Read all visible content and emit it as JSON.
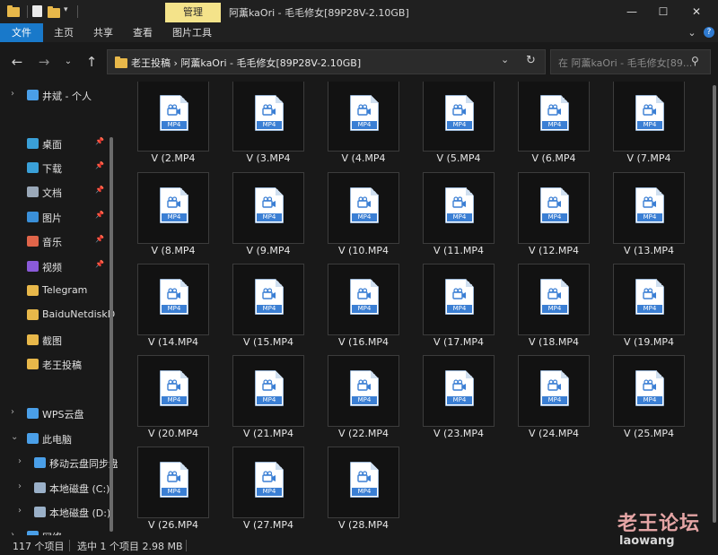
{
  "titlebar": {
    "manage_tab": "管理",
    "window_title": "阿薰kaOri - 毛毛修女[89P28V-2.10GB]",
    "minimize": "—",
    "maximize": "☐",
    "close": "✕"
  },
  "ribbon": {
    "tabs": [
      "文件",
      "主页",
      "共享",
      "查看",
      "图片工具"
    ]
  },
  "address": {
    "crumbs": "老王投稿  ›  阿薰kaOri - 毛毛修女[89P28V-2.10GB]",
    "search_placeholder": "在 阿薰kaOri - 毛毛修女[89..."
  },
  "sidebar": {
    "items": [
      {
        "label": "井斌 - 个人",
        "icon": "cloud-icon",
        "color": "#4a9fe8"
      },
      {
        "label": "桌面",
        "icon": "desktop-icon",
        "color": "#3aa0d8"
      },
      {
        "label": "下载",
        "icon": "download-icon",
        "color": "#3aa0d8"
      },
      {
        "label": "文档",
        "icon": "document-icon",
        "color": "#9aa8b8"
      },
      {
        "label": "图片",
        "icon": "pictures-icon",
        "color": "#3a8fd8"
      },
      {
        "label": "音乐",
        "icon": "music-icon",
        "color": "#e0654a"
      },
      {
        "label": "视频",
        "icon": "video-icon",
        "color": "#8a5ad8"
      },
      {
        "label": "Telegram",
        "icon": "folder-icon",
        "color": "#e8b84a"
      },
      {
        "label": "BaiduNetdiskD",
        "icon": "folder-icon",
        "color": "#e8b84a"
      },
      {
        "label": "截图",
        "icon": "folder-icon",
        "color": "#e8b84a"
      },
      {
        "label": "老王投稿",
        "icon": "folder-icon",
        "color": "#e8b84a"
      },
      {
        "label": "WPS云盘",
        "icon": "cloud-icon",
        "color": "#4a9fe8"
      },
      {
        "label": "此电脑",
        "icon": "computer-icon",
        "color": "#4a9fe8"
      },
      {
        "label": "移动云盘同步盘",
        "icon": "cloud-sync-icon",
        "color": "#4a9fe8"
      },
      {
        "label": "本地磁盘 (C:)",
        "icon": "drive-icon",
        "color": "#9ab0c8"
      },
      {
        "label": "本地磁盘 (D:)",
        "icon": "drive-icon",
        "color": "#9ab0c8"
      },
      {
        "label": "网络",
        "icon": "network-icon",
        "color": "#4a9fe8"
      }
    ]
  },
  "files": [
    "V (2.MP4",
    "V (3.MP4",
    "V (4.MP4",
    "V (5.MP4",
    "V (6.MP4",
    "V (7.MP4",
    "V (8.MP4",
    "V (9.MP4",
    "V (10.MP4",
    "V (11.MP4",
    "V (12.MP4",
    "V (13.MP4",
    "V (14.MP4",
    "V (15.MP4",
    "V (16.MP4",
    "V (17.MP4",
    "V (18.MP4",
    "V (19.MP4",
    "V (20.MP4",
    "V (21.MP4",
    "V (22.MP4",
    "V (23.MP4",
    "V (24.MP4",
    "V (25.MP4",
    "V (26.MP4",
    "V (27.MP4",
    "V (28.MP4"
  ],
  "file_badge": "MP4",
  "status": {
    "count": "117 个项目",
    "selection": "选中 1 个项目  2.98 MB"
  },
  "watermark": {
    "line1": "老王论坛",
    "line2": "laowang"
  }
}
